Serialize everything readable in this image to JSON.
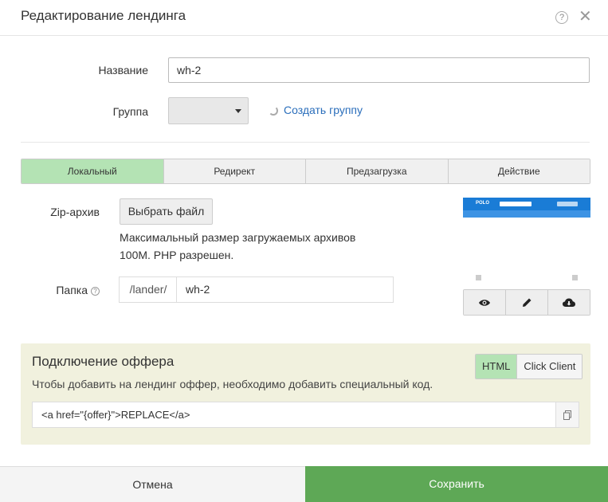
{
  "header": {
    "title": "Редактирование лендинга",
    "help_glyph": "?",
    "close_glyph": "✕"
  },
  "form": {
    "name_label": "Название",
    "name_value": "wh-2",
    "group_label": "Группа",
    "group_value": "",
    "create_group_link": "Создать группу"
  },
  "tabs": [
    {
      "label": "Локальный",
      "active": true
    },
    {
      "label": "Редирект",
      "active": false
    },
    {
      "label": "Предзагрузка",
      "active": false
    },
    {
      "label": "Действие",
      "active": false
    }
  ],
  "local": {
    "zip_label": "Zip-архив",
    "choose_file_label": "Выбрать файл",
    "hint_line1": "Максимальный размер загружаемых архивов",
    "hint_line2": "100M. PHP разрешен.",
    "folder_label": "Папка",
    "info_glyph": "?",
    "folder_prefix": "/lander/",
    "folder_value": "wh-2"
  },
  "preview": {
    "logo_text": "POLO",
    "actions": [
      "eye-icon",
      "pencil-icon",
      "cloud-download-icon"
    ]
  },
  "offer": {
    "title": "Подключение оффера",
    "description": "Чтобы добавить на лендинг оффер, необходимо добавить специальный код.",
    "mode_html": "HTML",
    "mode_click_client": "Click Client",
    "code_value": "<a href=\"{offer}\">REPLACE</a>"
  },
  "footer": {
    "cancel_label": "Отмена",
    "save_label": "Сохранить"
  },
  "colors": {
    "accent_green": "#5ea856",
    "active_tab": "#b4e3b4",
    "link_blue": "#2a6ebb",
    "offer_bg": "#f1f1de"
  }
}
